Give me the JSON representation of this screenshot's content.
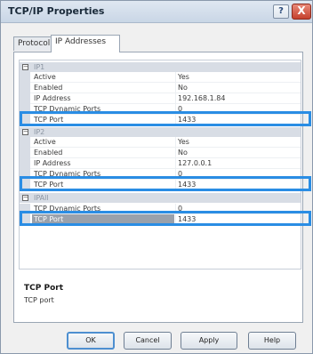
{
  "window": {
    "title": "TCP/IP Properties",
    "help_label": "?",
    "close_label": "X"
  },
  "tabs": [
    {
      "label": "Protocol",
      "active": false
    },
    {
      "label": "IP Addresses",
      "active": true
    }
  ],
  "groups": [
    {
      "name": "IP1",
      "rows": [
        {
          "key": "Active",
          "value": "Yes"
        },
        {
          "key": "Enabled",
          "value": "No"
        },
        {
          "key": "IP Address",
          "value": "192.168.1.84"
        },
        {
          "key": "TCP Dynamic Ports",
          "value": "0"
        },
        {
          "key": "TCP Port",
          "value": "1433"
        }
      ]
    },
    {
      "name": "IP2",
      "rows": [
        {
          "key": "Active",
          "value": "Yes"
        },
        {
          "key": "Enabled",
          "value": "No"
        },
        {
          "key": "IP Address",
          "value": "127.0.0.1"
        },
        {
          "key": "TCP Dynamic Ports",
          "value": "0"
        },
        {
          "key": "TCP Port",
          "value": "1433"
        }
      ]
    },
    {
      "name": "IPAll",
      "rows": [
        {
          "key": "TCP Dynamic Ports",
          "value": "0"
        },
        {
          "key": "TCP Port",
          "value": "1433"
        }
      ]
    }
  ],
  "description": {
    "title": "TCP Port",
    "text": "TCP port"
  },
  "buttons": {
    "ok": "OK",
    "cancel": "Cancel",
    "apply": "Apply",
    "help": "Help"
  },
  "colors": {
    "highlight": "#2a8de4",
    "selection": "#9aa1ab"
  }
}
